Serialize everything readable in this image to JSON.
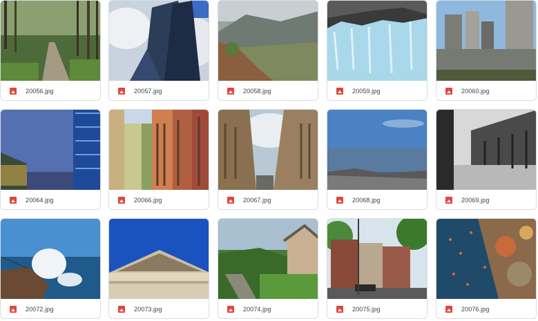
{
  "files": [
    {
      "name": "20056.jpg",
      "icon": "image-file-icon",
      "subject": "forest-path"
    },
    {
      "name": "20057.jpg",
      "icon": "image-file-icon",
      "subject": "skyscraper"
    },
    {
      "name": "20058.jpg",
      "icon": "image-file-icon",
      "subject": "mountain-hillside"
    },
    {
      "name": "20059.jpg",
      "icon": "image-file-icon",
      "subject": "glacier"
    },
    {
      "name": "20060.jpg",
      "icon": "image-file-icon",
      "subject": "city-skyline"
    },
    {
      "name": "20064.jpg",
      "icon": "image-file-icon",
      "subject": "glass-buildings"
    },
    {
      "name": "20066.jpg",
      "icon": "image-file-icon",
      "subject": "colorful-street"
    },
    {
      "name": "20067.jpg",
      "icon": "image-file-icon",
      "subject": "building-canyon"
    },
    {
      "name": "20068.jpg",
      "icon": "image-file-icon",
      "subject": "coastal-city"
    },
    {
      "name": "20069.jpg",
      "icon": "image-file-icon",
      "subject": "bw-street"
    },
    {
      "name": "20072.jpg",
      "icon": "image-file-icon",
      "subject": "ocean-wave"
    },
    {
      "name": "20073.jpg",
      "icon": "image-file-icon",
      "subject": "pediment"
    },
    {
      "name": "20074.jpg",
      "icon": "image-file-icon",
      "subject": "village-stream"
    },
    {
      "name": "20075.jpg",
      "icon": "image-file-icon",
      "subject": "row-houses"
    },
    {
      "name": "20076.jpg",
      "icon": "image-file-icon",
      "subject": "coral-reef"
    }
  ],
  "colors": {
    "file_icon": "#e2453c",
    "card_border": "#dadce0",
    "text": "#3c4043"
  }
}
